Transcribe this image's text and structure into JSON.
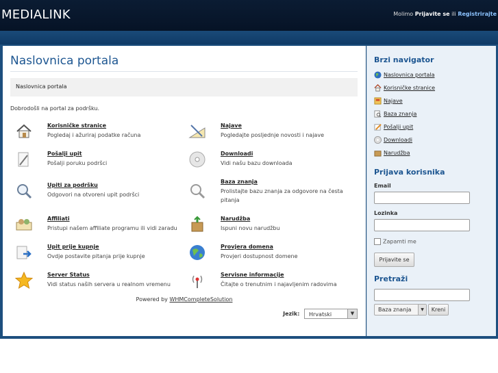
{
  "header": {
    "logo": "MEDIALINK",
    "login_prefix": "Molimo",
    "login_link": "Prijavite se",
    "login_mid": "ili",
    "register_link": "Registrirajte"
  },
  "main": {
    "title": "Naslovnica portala",
    "breadcrumb": "Naslovnica portala",
    "welcome": "Dobrodošli na portal za podršku.",
    "items": [
      {
        "title": "Korisničke stranice",
        "desc": "Pogledaj i ažuriraj podatke računa",
        "icon": "home-icon"
      },
      {
        "title": "Najave",
        "desc": "Pogledajte posljednje novosti i najave",
        "icon": "announcement-icon"
      },
      {
        "title": "Pošalji upit",
        "desc": "Pošalji poruku podršci",
        "icon": "pencil-icon"
      },
      {
        "title": "Downloadi",
        "desc": "Vidi našu bazu downloada",
        "icon": "disc-icon"
      },
      {
        "title": "Upiti za podršku",
        "desc": "Odgovori na otvoreni upit podršci",
        "icon": "magnifier-icon"
      },
      {
        "title": "Baza znanja",
        "desc": "Prolistajte bazu znanja za odgovore na česta pitanja",
        "icon": "knowledgebase-icon"
      },
      {
        "title": "Affiliati",
        "desc": "Pristupi našem affiliate programu ili vidi zaradu",
        "icon": "affiliate-icon"
      },
      {
        "title": "Narudžba",
        "desc": "Ispuni novu narudžbu",
        "icon": "package-icon"
      },
      {
        "title": "Upit prije kupnje",
        "desc": "Ovdje postavite pitanja prije kupnje",
        "icon": "presales-icon"
      },
      {
        "title": "Provjera domena",
        "desc": "Provjeri dostupnost domene",
        "icon": "globe-icon"
      },
      {
        "title": "Server Status",
        "desc": "Vidi status naših servera u realnom vremenu",
        "icon": "star-icon"
      },
      {
        "title": "Servisne informacije",
        "desc": "Čitajte o trenutnim i najavljenim radovima",
        "icon": "antenna-icon"
      }
    ],
    "powered_prefix": "Powered by",
    "powered_link": "WHMCompleteSolution",
    "language_label": "Jezik:",
    "language_value": "Hrvatski"
  },
  "sidebar": {
    "nav_title": "Brzi navigator",
    "nav_items": [
      {
        "label": "Naslovnica portala",
        "icon": "globe-icon"
      },
      {
        "label": "Korisničke stranice",
        "icon": "home-icon"
      },
      {
        "label": "Najave",
        "icon": "announcement-icon"
      },
      {
        "label": "Baza znanja",
        "icon": "document-search-icon"
      },
      {
        "label": "Pošalji upit",
        "icon": "pencil-icon"
      },
      {
        "label": "Downloadi",
        "icon": "disc-icon"
      },
      {
        "label": "Narudžba",
        "icon": "package-icon"
      }
    ],
    "login_title": "Prijava korisnika",
    "email_label": "Email",
    "password_label": "Lozinka",
    "remember_label": "Zapamti me",
    "login_button": "Prijavite se",
    "search_title": "Pretraži",
    "search_select": "Baza znanja",
    "search_button": "Kreni"
  },
  "colors": {
    "header_bg": "#061326",
    "accent": "#1d5691",
    "frame": "#1d4f7e"
  }
}
